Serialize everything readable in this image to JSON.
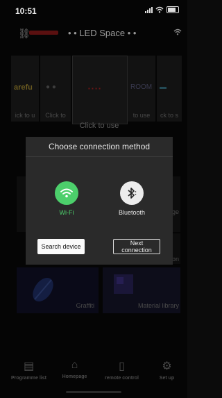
{
  "status_bar": {
    "time": "10:51"
  },
  "header": {
    "title": "• • LED Space • •"
  },
  "carousel": {
    "cards": [
      {
        "art": "arefu",
        "caption": "ick to u"
      },
      {
        "art": "",
        "caption": "Click to"
      },
      {
        "art": "",
        "caption": ""
      },
      {
        "art": "ROOM",
        "caption": "to use"
      },
      {
        "art": "",
        "caption": "ck to s"
      }
    ],
    "main_caption": "Click to use"
  },
  "tiles": {
    "graffiti_label": "Graffiti",
    "material_label": "Material library",
    "edge_label_1": "ge",
    "edge_label_2": "on"
  },
  "dialog": {
    "title": "Choose connection method",
    "wifi_label": "Wi-Fi",
    "bluetooth_label": "Bluetooth",
    "search_button": "Search device",
    "next_button_line1": "Next",
    "next_button_line2": "connection"
  },
  "tabbar": {
    "tabs": [
      {
        "label": "Programme list"
      },
      {
        "label": "Homepage"
      },
      {
        "label": "remote control"
      },
      {
        "label": "Set up"
      }
    ]
  },
  "colors": {
    "wifi_green": "#4ccf6b",
    "dialog_bg": "#2a2a2a"
  }
}
